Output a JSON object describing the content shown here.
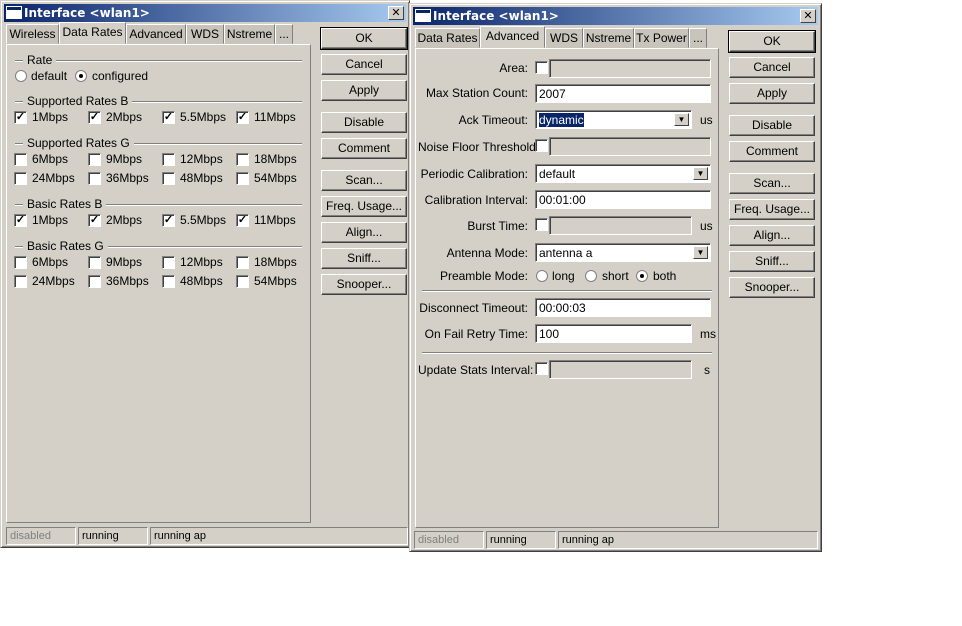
{
  "left": {
    "title": "Interface <wlan1>",
    "tabs": [
      "Wireless",
      "Data Rates",
      "Advanced",
      "WDS",
      "Nstreme",
      "..."
    ],
    "buttons": [
      "OK",
      "Cancel",
      "Apply",
      "Disable",
      "Comment",
      "Scan...",
      "Freq. Usage...",
      "Align...",
      "Sniff...",
      "Snooper..."
    ],
    "rate": {
      "label": "Rate",
      "default": "default",
      "configured": "configured",
      "selected": "configured"
    },
    "groups": [
      {
        "label": "Supported Rates B",
        "items": [
          {
            "l": "1Mbps",
            "c": true
          },
          {
            "l": "2Mbps",
            "c": true
          },
          {
            "l": "5.5Mbps",
            "c": true
          },
          {
            "l": "11Mbps",
            "c": true
          }
        ]
      },
      {
        "label": "Supported Rates G",
        "items": [
          {
            "l": "6Mbps",
            "c": false
          },
          {
            "l": "9Mbps",
            "c": false
          },
          {
            "l": "12Mbps",
            "c": false
          },
          {
            "l": "18Mbps",
            "c": false
          },
          {
            "l": "24Mbps",
            "c": false
          },
          {
            "l": "36Mbps",
            "c": false
          },
          {
            "l": "48Mbps",
            "c": false
          },
          {
            "l": "54Mbps",
            "c": false
          }
        ]
      },
      {
        "label": "Basic Rates B",
        "items": [
          {
            "l": "1Mbps",
            "c": true
          },
          {
            "l": "2Mbps",
            "c": true
          },
          {
            "l": "5.5Mbps",
            "c": true
          },
          {
            "l": "11Mbps",
            "c": true
          }
        ]
      },
      {
        "label": "Basic Rates G",
        "items": [
          {
            "l": "6Mbps",
            "c": false
          },
          {
            "l": "9Mbps",
            "c": false
          },
          {
            "l": "12Mbps",
            "c": false
          },
          {
            "l": "18Mbps",
            "c": false
          },
          {
            "l": "24Mbps",
            "c": false
          },
          {
            "l": "36Mbps",
            "c": false
          },
          {
            "l": "48Mbps",
            "c": false
          },
          {
            "l": "54Mbps",
            "c": false
          }
        ]
      }
    ],
    "status": [
      "disabled",
      "running",
      "running ap"
    ]
  },
  "right": {
    "title": "Interface <wlan1>",
    "tabs": [
      "Data Rates",
      "Advanced",
      "WDS",
      "Nstreme",
      "Tx Power",
      "..."
    ],
    "buttons": [
      "OK",
      "Cancel",
      "Apply",
      "Disable",
      "Comment",
      "Scan...",
      "Freq. Usage...",
      "Align...",
      "Sniff...",
      "Snooper..."
    ],
    "form": {
      "area": {
        "label": "Area:",
        "value": ""
      },
      "max_station": {
        "label": "Max Station Count:",
        "value": "2007"
      },
      "ack_timeout": {
        "label": "Ack Timeout:",
        "value": "dynamic",
        "unit": "us"
      },
      "noise_floor": {
        "label": "Noise Floor Threshold:",
        "value": ""
      },
      "periodic_cal": {
        "label": "Periodic Calibration:",
        "value": "default"
      },
      "cal_interval": {
        "label": "Calibration Interval:",
        "value": "00:01:00"
      },
      "burst_time": {
        "label": "Burst Time:",
        "value": "",
        "unit": "us"
      },
      "antenna_mode": {
        "label": "Antenna Mode:",
        "value": "antenna a"
      },
      "preamble": {
        "label": "Preamble Mode:",
        "options": [
          "long",
          "short",
          "both"
        ],
        "selected": "both"
      },
      "disconnect_timeout": {
        "label": "Disconnect Timeout:",
        "value": "00:00:03"
      },
      "on_fail_retry": {
        "label": "On Fail Retry Time:",
        "value": "100",
        "unit": "ms"
      },
      "update_stats": {
        "label": "Update Stats Interval:",
        "value": "",
        "unit": "s"
      }
    },
    "status": [
      "disabled",
      "running",
      "running ap"
    ]
  }
}
